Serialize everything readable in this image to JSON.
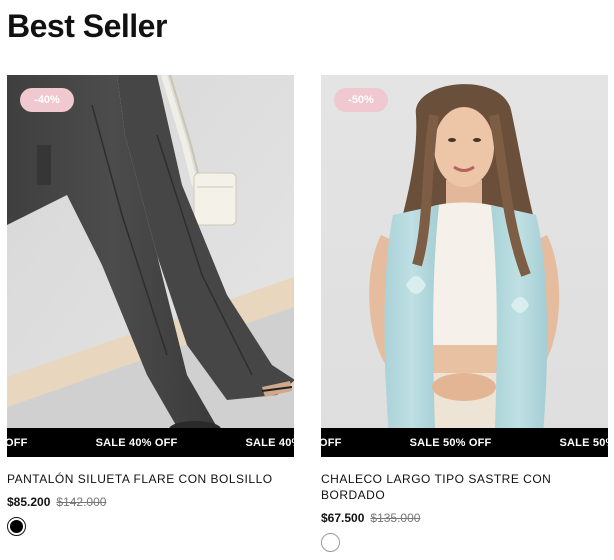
{
  "section": {
    "title": "Best Seller"
  },
  "products": [
    {
      "badge": "-40%",
      "sale_text": "SALE 40% OFF",
      "name": "PANTALÓN SILUETA FLARE CON BOLSILLO",
      "price": "$85.200",
      "old_price": "$142.000",
      "swatch_color": "#000000"
    },
    {
      "badge": "-50%",
      "sale_text": "SALE 50% OFF",
      "name": "CHALECO LARGO TIPO SASTRE CON BORDADO",
      "price": "$67.500",
      "old_price": "$135.000",
      "swatch_color": "#ffffff"
    }
  ],
  "colors": {
    "badge_bg": "#f0c8cf",
    "strip_bg": "#000000",
    "text": "#111111",
    "old_price": "#777777"
  },
  "icons": [
    "bolt-icon"
  ]
}
